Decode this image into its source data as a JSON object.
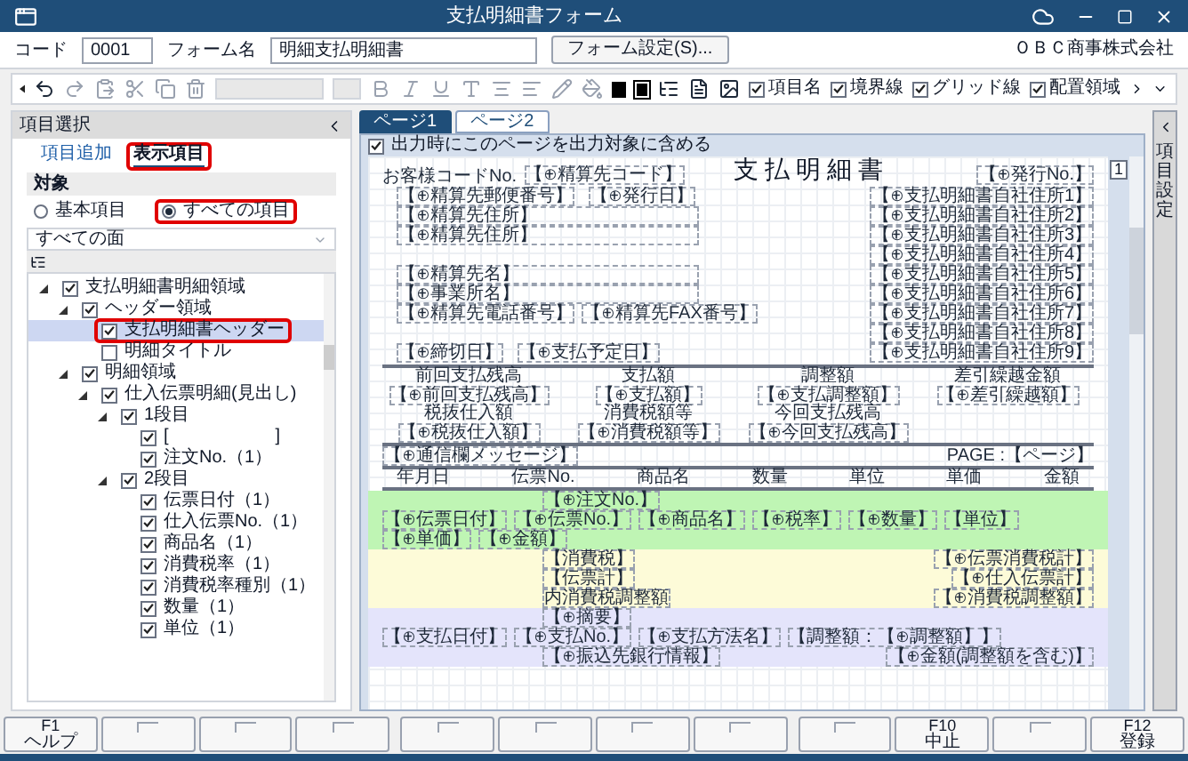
{
  "window": {
    "title": "支払明細書フォーム",
    "company": "ＯＢＣ商事株式会社"
  },
  "header": {
    "code_label": "コード",
    "code": "0001",
    "form_name_label": "フォーム名",
    "form_name": "明細支払明細書",
    "settings_button": "フォーム設定(S)..."
  },
  "toolbar": {
    "options": [
      {
        "label": "項目名",
        "checked": true
      },
      {
        "label": "境界線",
        "checked": true
      },
      {
        "label": "グリッド線",
        "checked": true
      },
      {
        "label": "配置領域",
        "checked": true
      }
    ]
  },
  "left_panel": {
    "title": "項目選択",
    "tabs": [
      {
        "label": "項目追加",
        "selected": false,
        "marked": false
      },
      {
        "label": "表示項目",
        "selected": true,
        "marked": true
      }
    ],
    "target_label": "対象",
    "radios": [
      {
        "label": "基本項目",
        "selected": false,
        "marked": false
      },
      {
        "label": "すべての項目",
        "selected": true,
        "marked": true
      }
    ],
    "filter": "すべての面",
    "tree": [
      {
        "label": "支払明細書明細領域",
        "checked": true,
        "expanded": true,
        "selected": false,
        "marked": false,
        "children": [
          {
            "label": "ヘッダー領域",
            "checked": true,
            "expanded": true,
            "selected": false,
            "marked": false,
            "children": [
              {
                "label": "支払明細書ヘッダー",
                "checked": true,
                "selected": true,
                "marked": true
              },
              {
                "label": "明細タイトル",
                "checked": false,
                "selected": false,
                "marked": false
              }
            ]
          },
          {
            "label": "明細領域",
            "checked": true,
            "expanded": true,
            "selected": false,
            "marked": false,
            "children": [
              {
                "label": "仕入伝票明細(見出し)",
                "checked": true,
                "expanded": true,
                "selected": false,
                "marked": false,
                "children": [
                  {
                    "label": "1段目",
                    "checked": true,
                    "expanded": true,
                    "selected": false,
                    "marked": false,
                    "children": [
                      {
                        "label": "[　　　　　　]",
                        "checked": true,
                        "selected": false,
                        "marked": false
                      },
                      {
                        "label": "注文No.（1）",
                        "checked": true,
                        "selected": false,
                        "marked": false
                      }
                    ]
                  },
                  {
                    "label": "2段目",
                    "checked": true,
                    "expanded": true,
                    "selected": false,
                    "marked": false,
                    "children": [
                      {
                        "label": "伝票日付（1）",
                        "checked": true,
                        "selected": false,
                        "marked": false
                      },
                      {
                        "label": "仕入伝票No.（1）",
                        "checked": true,
                        "selected": false,
                        "marked": false
                      },
                      {
                        "label": "商品名（1）",
                        "checked": true,
                        "selected": false,
                        "marked": false
                      },
                      {
                        "label": "消費税率（1）",
                        "checked": true,
                        "selected": false,
                        "marked": false
                      },
                      {
                        "label": "消費税率種別（1）",
                        "checked": true,
                        "selected": false,
                        "marked": false
                      },
                      {
                        "label": "数量（1）",
                        "checked": true,
                        "selected": false,
                        "marked": false
                      },
                      {
                        "label": "単位（1）",
                        "checked": true,
                        "selected": false,
                        "marked": false
                      }
                    ]
                  }
                ]
              }
            ]
          }
        ]
      }
    ]
  },
  "editor": {
    "tabs": [
      {
        "label": "ページ1",
        "selected": true
      },
      {
        "label": "ページ2",
        "selected": false
      }
    ],
    "include_page": {
      "label": "出力時にこのページを出力対象に含める",
      "checked": true
    },
    "page_marker": "1",
    "form": {
      "customer_code_label": "お客様コードNo.",
      "customer_code": "【⊕精算先コード】",
      "title": "支 払 明 細 書",
      "postal": "【⊕精算先郵便番号】",
      "issue_date": "【⊕発行日】",
      "issue_no": "【⊕発行No.】",
      "left_fields": [
        "【⊕精算先住所】",
        "【⊕精算先住所】",
        "【⊕精算先名】",
        "【⊕事業所名】"
      ],
      "phone": "【⊕精算先電話番号】",
      "fax": "【⊕精算先FAX番号】",
      "company_address": [
        "【⊕支払明細書自社住所1】",
        "【⊕支払明細書自社住所2】",
        "【⊕支払明細書自社住所3】",
        "【⊕支払明細書自社住所4】",
        "【⊕支払明細書自社住所5】",
        "【⊕支払明細書自社住所6】",
        "【⊕支払明細書自社住所7】",
        "【⊕支払明細書自社住所8】",
        "【⊕支払明細書自社住所9】"
      ],
      "closing_date": "【⊕締切日】",
      "payment_date": "【⊕支払予定日】",
      "summary": [
        {
          "label": "前回支払残高",
          "value": "【⊕前回支払残高】"
        },
        {
          "label": "支払額",
          "value": "【⊕支払額】"
        },
        {
          "label": "調整額",
          "value": "【⊕支払調整額】"
        },
        {
          "label": "差引繰越金額",
          "value": "【⊕差引繰越額】"
        },
        {
          "label": "税抜仕入額",
          "value": "【⊕税抜仕入額】"
        },
        {
          "label": "消費税額等",
          "value": "【⊕消費税額等】"
        },
        {
          "label": "今回支払残高",
          "value": "【⊕今回支払残高】"
        }
      ],
      "message": "【⊕通信欄メッセージ】",
      "page": "PAGE :【ページ】",
      "columns": [
        "年月日",
        "伝票No.",
        "商品名",
        "数量",
        "単位",
        "単価",
        "金額"
      ],
      "bands": [
        {
          "color": "#bff5b4",
          "lines": [
            {
              "indent": true,
              "items": [
                "【⊕注文No.】"
              ]
            },
            {
              "indent": false,
              "items": [
                "【⊕伝票日付】",
                "【⊕伝票No.】",
                "【⊕商品名】",
                "【⊕税率】",
                "【⊕数量】",
                "【単位】",
                "【⊕単価】",
                "【⊕金額】"
              ]
            }
          ]
        },
        {
          "color": "#fdfbd8",
          "lines": [
            {
              "indent": true,
              "items": [
                "【消費税】"
              ],
              "right": "【⊕伝票消費税計】"
            },
            {
              "indent": true,
              "items": [
                "【伝票計】"
              ],
              "right": "【⊕仕入伝票計】"
            },
            {
              "indent": true,
              "items": [
                "内消費税調整額"
              ],
              "right": "【⊕消費税調整額】"
            }
          ]
        },
        {
          "color": "#e4e4fb",
          "lines": [
            {
              "indent": true,
              "items": [
                "【⊕摘要】"
              ]
            },
            {
              "indent": false,
              "items": [
                "【⊕支払日付】",
                "【⊕支払No.】",
                "【⊕支払方法名】",
                "【調整額：【⊕調整額】】"
              ]
            },
            {
              "indent": true,
              "items": [
                "【⊕振込先銀行情報】"
              ],
              "right": "【⊕金額(調整額を含む)】"
            }
          ]
        }
      ]
    }
  },
  "right_panel": {
    "title": "項目設定"
  },
  "function_keys": [
    {
      "kind": "key",
      "key": "F1",
      "label": "ヘルプ"
    },
    {
      "kind": "blank"
    },
    {
      "kind": "blank"
    },
    {
      "kind": "blank"
    },
    {
      "kind": "blank"
    },
    {
      "kind": "blank"
    },
    {
      "kind": "blank"
    },
    {
      "kind": "blank"
    },
    {
      "kind": "blank"
    },
    {
      "kind": "key",
      "key": "F10",
      "label": "中止"
    },
    {
      "kind": "blank"
    },
    {
      "kind": "key",
      "key": "F12",
      "label": "登録"
    }
  ]
}
